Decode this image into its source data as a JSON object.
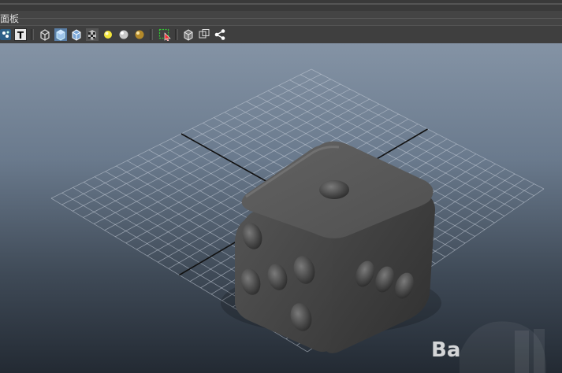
{
  "menubar": {
    "label": "面板"
  },
  "toolbar": {
    "text_tool_glyph": "T",
    "icons": [
      "camera-tools-icon",
      "text-tool-icon",
      "wireframe-icon",
      "smooth-shade-icon",
      "wireframe-on-shaded-icon",
      "textured-icon",
      "use-all-lights-icon",
      "shadows-icon",
      "default-material-icon",
      "isolate-select-icon",
      "xray-icon",
      "xray-joints-icon",
      "hardware-texturing-icon"
    ]
  },
  "viewport": {
    "object": "die-model",
    "die_pips": {
      "top_face": 1,
      "front_face": 5,
      "right_face": 3
    }
  },
  "watermark": {
    "text": "Ba"
  },
  "colors": {
    "viewport_top": "#8493a5",
    "viewport_bottom": "#232a33",
    "grid": "#c8d0da",
    "grid_axis": "#111111",
    "die": "#4a4a4a"
  }
}
